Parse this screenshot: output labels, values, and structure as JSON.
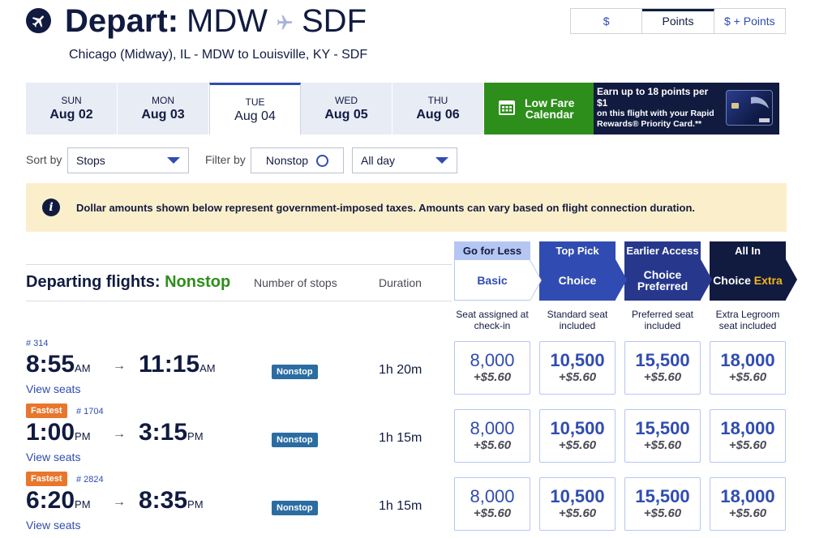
{
  "header": {
    "depart_label": "Depart:",
    "origin": "MDW",
    "destination": "SDF",
    "subtitle": "Chicago (Midway), IL - MDW to Louisville, KY - SDF"
  },
  "currency_toggle": [
    "$",
    "Points",
    "$ + Points"
  ],
  "dates": [
    {
      "dow": "SUN",
      "date": "Aug 02"
    },
    {
      "dow": "MON",
      "date": "Aug 03"
    },
    {
      "dow": "TUE",
      "date": "Aug 04"
    },
    {
      "dow": "WED",
      "date": "Aug 05"
    },
    {
      "dow": "THU",
      "date": "Aug 06"
    }
  ],
  "low_fare": {
    "line1": "Low Fare",
    "line2": "Calendar"
  },
  "promo": {
    "headline": "Earn up to 18 points per $1",
    "line2": "on this flight with your Rapid",
    "line3": "Rewards® Priority Card.**"
  },
  "controls": {
    "sort_label": "Sort by",
    "sort_value": "Stops",
    "filter_label": "Filter by",
    "nonstop_label": "Nonstop",
    "time_value": "All day"
  },
  "notice": "Dollar amounts shown below represent government-imposed taxes. Amounts can vary based on flight connection duration.",
  "table": {
    "title": "Departing flights:",
    "title_filter": "Nonstop",
    "col_stops": "Number of stops",
    "col_duration": "Duration"
  },
  "fares": [
    {
      "tag": "Go for Less",
      "name": "Basic",
      "name2": "",
      "desc1": "Seat assigned at",
      "desc2": "check-in"
    },
    {
      "tag": "Top Pick",
      "name": "Choice",
      "name2": "",
      "desc1": "Standard seat",
      "desc2": "included"
    },
    {
      "tag": "Earlier Access",
      "name": "Choice",
      "name2": "Preferred",
      "desc1": "Preferred seat",
      "desc2": "included"
    },
    {
      "tag": "All In",
      "name": "Choice",
      "name2": "Extra",
      "desc1": "Extra Legroom",
      "desc2": "seat included"
    }
  ],
  "flights": [
    {
      "badge": "",
      "number": "# 314",
      "dep": "8:55",
      "dep_ampm": "AM",
      "arr": "11:15",
      "arr_ampm": "AM",
      "view_seats": "View seats",
      "stops": "Nonstop",
      "duration": "1h 20m",
      "prices": [
        {
          "pts": "8,000",
          "tax": "+$5.60"
        },
        {
          "pts": "10,500",
          "tax": "+$5.60"
        },
        {
          "pts": "15,500",
          "tax": "+$5.60"
        },
        {
          "pts": "18,000",
          "tax": "+$5.60"
        }
      ]
    },
    {
      "badge": "Fastest",
      "number": "# 1704",
      "dep": "1:00",
      "dep_ampm": "PM",
      "arr": "3:15",
      "arr_ampm": "PM",
      "view_seats": "View seats",
      "stops": "Nonstop",
      "duration": "1h 15m",
      "prices": [
        {
          "pts": "8,000",
          "tax": "+$5.60"
        },
        {
          "pts": "10,500",
          "tax": "+$5.60"
        },
        {
          "pts": "15,500",
          "tax": "+$5.60"
        },
        {
          "pts": "18,000",
          "tax": "+$5.60"
        }
      ]
    },
    {
      "badge": "Fastest",
      "number": "# 2824",
      "dep": "6:20",
      "dep_ampm": "PM",
      "arr": "8:35",
      "arr_ampm": "PM",
      "view_seats": "View seats",
      "stops": "Nonstop",
      "duration": "1h 15m",
      "prices": [
        {
          "pts": "8,000",
          "tax": "+$5.60"
        },
        {
          "pts": "10,500",
          "tax": "+$5.60"
        },
        {
          "pts": "15,500",
          "tax": "+$5.60"
        },
        {
          "pts": "18,000",
          "tax": "+$5.60"
        }
      ]
    }
  ],
  "arrow_glyph": "→",
  "colors": {
    "navy": "#111b40",
    "blue": "#304cb2",
    "green": "#2e8e1b",
    "orange": "#e8762c",
    "gold": "#f6b31c",
    "notice_bg": "#fbefcb"
  }
}
